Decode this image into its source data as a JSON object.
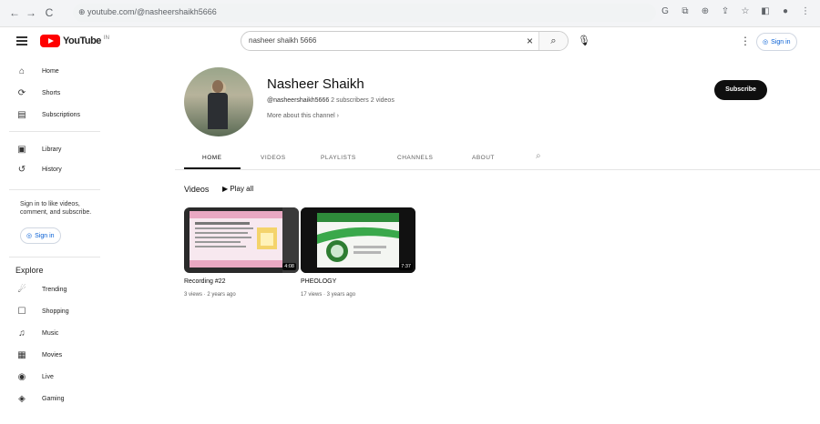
{
  "browser": {
    "url": "youtube.com/@nasheershaikh5666",
    "back_icon": "←",
    "forward_icon": "→",
    "reload_icon": "C",
    "lock_icon": "⊕"
  },
  "masthead": {
    "logo_text": "YouTube",
    "logo_sup": "IN",
    "search_value": "nasheer shaikh 5666",
    "clear_icon": "×",
    "search_icon": "⌕",
    "signin_label": "Sign in"
  },
  "sidebar": {
    "items": [
      {
        "icon": "⌂",
        "label": "Home"
      },
      {
        "icon": "⟳",
        "label": "Shorts"
      },
      {
        "icon": "▤",
        "label": "Subscriptions"
      },
      {
        "icon": "▣",
        "label": "Library"
      },
      {
        "icon": "↺",
        "label": "History"
      }
    ],
    "signin_prompt": "Sign in to like videos, comment, and subscribe.",
    "signin_label": "Sign in",
    "explore_title": "Explore",
    "explore_items": [
      {
        "icon": "☄",
        "label": "Trending"
      },
      {
        "icon": "☐",
        "label": "Shopping"
      },
      {
        "icon": "♫",
        "label": "Music"
      },
      {
        "icon": "▦",
        "label": "Movies"
      },
      {
        "icon": "◉",
        "label": "Live"
      },
      {
        "icon": "◈",
        "label": "Gaming"
      }
    ]
  },
  "channel": {
    "name": "Nasheer Shaikh",
    "handle": "@nasheershaikh5666",
    "stats": "2 subscribers  2 videos",
    "about_link": "More about this channel",
    "subscribe_label": "Subscribe"
  },
  "tabs": [
    {
      "label": "HOME"
    },
    {
      "label": "VIDEOS"
    },
    {
      "label": "PLAYLISTS"
    },
    {
      "label": "CHANNELS"
    },
    {
      "label": "ABOUT"
    }
  ],
  "videos_section": {
    "title": "Videos",
    "play_all": "Play all",
    "videos": [
      {
        "title": "Recording #22",
        "meta": "3 views · 2 years ago",
        "duration": "4:08"
      },
      {
        "title": "PHEOLOGY",
        "meta": "17 views · 3 years ago",
        "duration": "7:37"
      }
    ]
  }
}
